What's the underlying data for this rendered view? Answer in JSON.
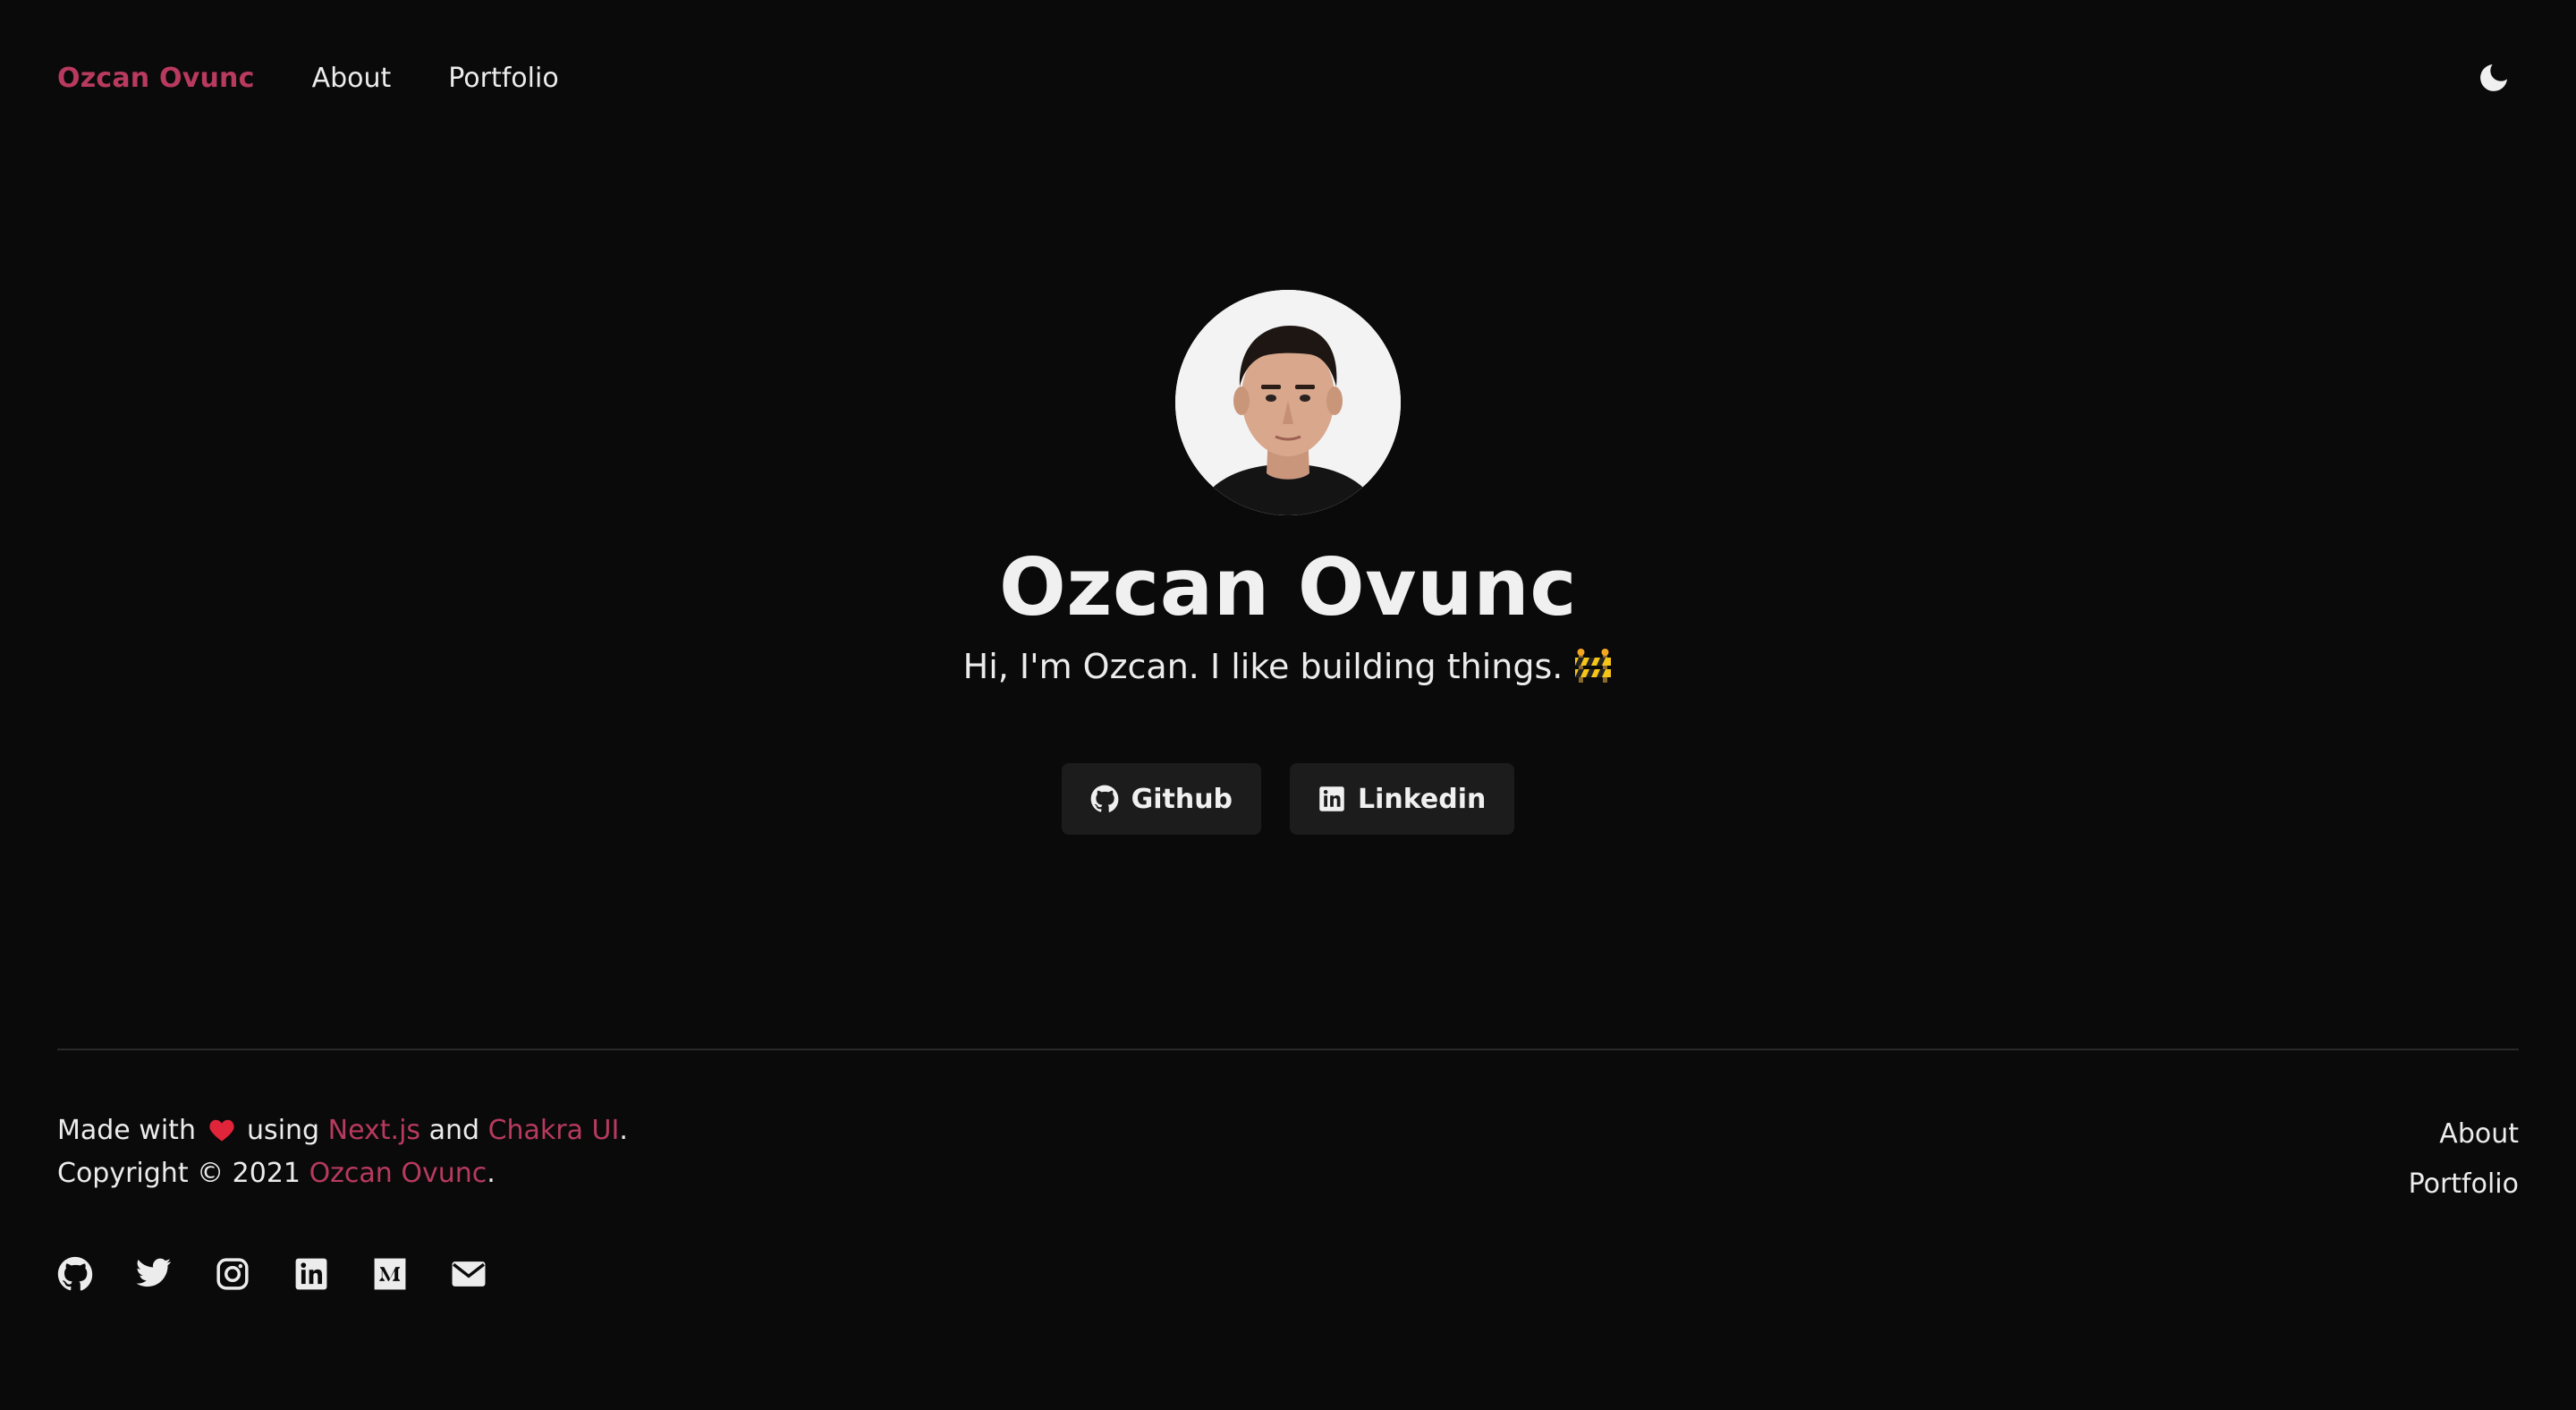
{
  "header": {
    "brand": "Ozcan Ovunc",
    "nav": [
      {
        "label": "About"
      },
      {
        "label": "Portfolio"
      }
    ],
    "theme_toggle_icon": "moon-icon"
  },
  "hero": {
    "title": "Ozcan Ovunc",
    "subtitle": "Hi, I'm Ozcan. I like building things.",
    "subtitle_emoji_icon": "construction-barrier-icon",
    "buttons": [
      {
        "label": "Github",
        "icon": "github-icon"
      },
      {
        "label": "Linkedin",
        "icon": "linkedin-icon"
      }
    ]
  },
  "footer": {
    "made_with": "Made with",
    "heart_icon": "heart-icon",
    "using": "using",
    "nextjs": "Next.js",
    "and": "and",
    "chakra": "Chakra UI",
    "period": ".",
    "copyright": "Copyright © 2021",
    "author": "Ozcan Ovunc",
    "nav": [
      {
        "label": "About"
      },
      {
        "label": "Portfolio"
      }
    ],
    "socials": [
      "github-icon",
      "twitter-icon",
      "instagram-icon",
      "linkedin-icon",
      "medium-icon",
      "mail-icon"
    ]
  },
  "colors": {
    "background": "#0a0a0a",
    "accent": "#b83a5e",
    "text": "#ececec",
    "button_bg": "#1c1c1c"
  }
}
